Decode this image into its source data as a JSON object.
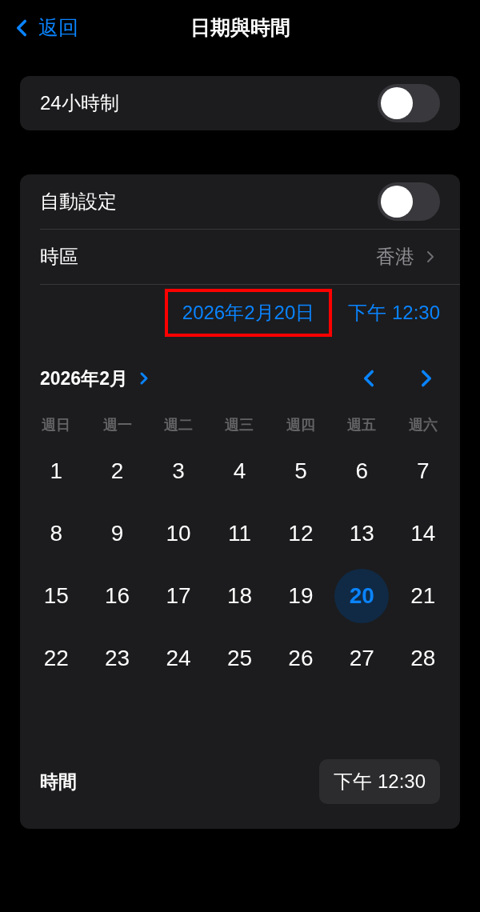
{
  "nav": {
    "back": "返回",
    "title": "日期與時間"
  },
  "clock_format": {
    "label": "24小時制",
    "on": false
  },
  "auto_set": {
    "label": "自動設定",
    "on": false
  },
  "time_zone": {
    "label": "時區",
    "value": "香港"
  },
  "selected": {
    "date": "2026年2月20日",
    "highlighted": true,
    "time": "下午 12:30"
  },
  "calendar": {
    "month": "2026年2月",
    "weekdays": [
      "週日",
      "週一",
      "週二",
      "週三",
      "週四",
      "週五",
      "週六"
    ],
    "days": [
      {
        "label": "1",
        "selected": false
      },
      {
        "label": "2",
        "selected": false
      },
      {
        "label": "3",
        "selected": false
      },
      {
        "label": "4",
        "selected": false
      },
      {
        "label": "5",
        "selected": false
      },
      {
        "label": "6",
        "selected": false
      },
      {
        "label": "7",
        "selected": false
      },
      {
        "label": "8",
        "selected": false
      },
      {
        "label": "9",
        "selected": false
      },
      {
        "label": "10",
        "selected": false
      },
      {
        "label": "11",
        "selected": false
      },
      {
        "label": "12",
        "selected": false
      },
      {
        "label": "13",
        "selected": false
      },
      {
        "label": "14",
        "selected": false
      },
      {
        "label": "15",
        "selected": false
      },
      {
        "label": "16",
        "selected": false
      },
      {
        "label": "17",
        "selected": false
      },
      {
        "label": "18",
        "selected": false
      },
      {
        "label": "19",
        "selected": false
      },
      {
        "label": "20",
        "selected": true
      },
      {
        "label": "21",
        "selected": false
      },
      {
        "label": "22",
        "selected": false
      },
      {
        "label": "23",
        "selected": false
      },
      {
        "label": "24",
        "selected": false
      },
      {
        "label": "25",
        "selected": false
      },
      {
        "label": "26",
        "selected": false
      },
      {
        "label": "27",
        "selected": false
      },
      {
        "label": "28",
        "selected": false
      }
    ]
  },
  "time_row": {
    "label": "時間",
    "value": "下午 12:30"
  }
}
